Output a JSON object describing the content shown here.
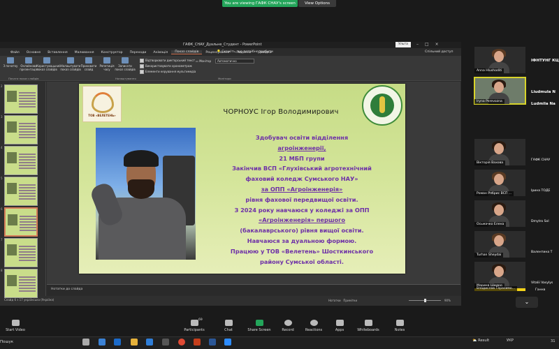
{
  "zoom": {
    "share_banner": "You are viewing ГАФК СНАУ's screen",
    "view_options": "View Options",
    "toolbar": {
      "start_video": "Start Video",
      "participants": "Participants",
      "participants_count": "69",
      "chat": "Chat",
      "share_screen": "Share Screen",
      "record": "Record",
      "reactions": "Reactions",
      "apps": "Apps",
      "whiteboards": "Whiteboards",
      "notes": "Notes"
    }
  },
  "ppt": {
    "window_title": "ГАФК_СНАУ_Дуальне_Студент - PowerPoint",
    "user_chip": "Ульта",
    "search": "Скажіть, що потрібно зробити",
    "share_label": "Спільний доступ",
    "tabs": [
      "Файл",
      "Основне",
      "Вставлення",
      "Малювання",
      "Конструктор",
      "Переходи",
      "Анімація",
      "Показ слайдів",
      "Рецензування",
      "Подання",
      "Довідка"
    ],
    "active_tab": "Показ слайдів",
    "ribbon_buttons": [
      "З початку",
      "Онлайнова презентація",
      "Користувацький показ слайдів",
      "Налаштувати показ слайдів",
      "Приховати слайд",
      "Репетиція часу",
      "Записати показ слайдів"
    ],
    "checkboxes": [
      "Відтворювати дикторський текст",
      "Використовувати хронометраж",
      "Елементи керування мультимедіа"
    ],
    "monitor_label": "Монітор",
    "monitor_value": "Автоматично",
    "group_labels": [
      "Почати показ слайдів",
      "Налаштування",
      "Монітори"
    ],
    "notes_placeholder": "Нотатки до слайда",
    "status_left": "Слайд 6 з 17  українська (Україна)",
    "status_notes": "Нотатки",
    "status_comments": "Примітки",
    "zoom": "90%"
  },
  "slide": {
    "logo_left_text": "ТОВ «ВЕЛЕТЕНЬ»",
    "name": "ЧОРНОУС Ігор Володимирович",
    "body_lines": [
      "Здобувач освіти відділення",
      "агроінженерії,",
      "21 МБП групи",
      "Закінчив ВСП «Глухівський агротехнічний",
      "фаховий коледж  Сумського НАУ»",
      "за ОПП «Агроінженерія»",
      "рівня фахової передвищої освіти.",
      "З 2024 року навчаюся у коледжі за ОПП",
      "«Агроінженерія» першого",
      "(бакалаврського) рівня вищої освіти.",
      "Навчаюся за дуальною формою.",
      "Працюю у ТОВ «Велетень» Шосткинського",
      "району Сумської області."
    ]
  },
  "thumbnails": [
    "2",
    "3",
    "4",
    "5",
    "6",
    "7",
    "8"
  ],
  "participants": [
    {
      "name": "Anna Hlushoditi",
      "side": "ІФНТУНГ КЦ"
    },
    {
      "name": "Iryna Perevozna",
      "side": "Liudmula N"
    },
    {
      "name": "",
      "side": "Ludmila Na"
    },
    {
      "name": "Вікторія Вахова",
      "side": "ГАФК СНАУ"
    },
    {
      "name": "Роман Рябрис ВСП ...",
      "side": "Ірина ТОДЕ"
    },
    {
      "name": "Осьмачко Елена",
      "side": "Dmytro Sol"
    },
    {
      "name": "Turhan Sheydai",
      "side": "Валентина Т"
    },
    {
      "name": "Марина Шидро",
      "side": "Vitalii Vasylys"
    },
    {
      "name": "Владислав Герасимо...",
      "side": "Ганна"
    }
  ],
  "taskbar": {
    "search": "Пошук",
    "result": "Result",
    "lang": "УКР",
    "time": "31"
  }
}
